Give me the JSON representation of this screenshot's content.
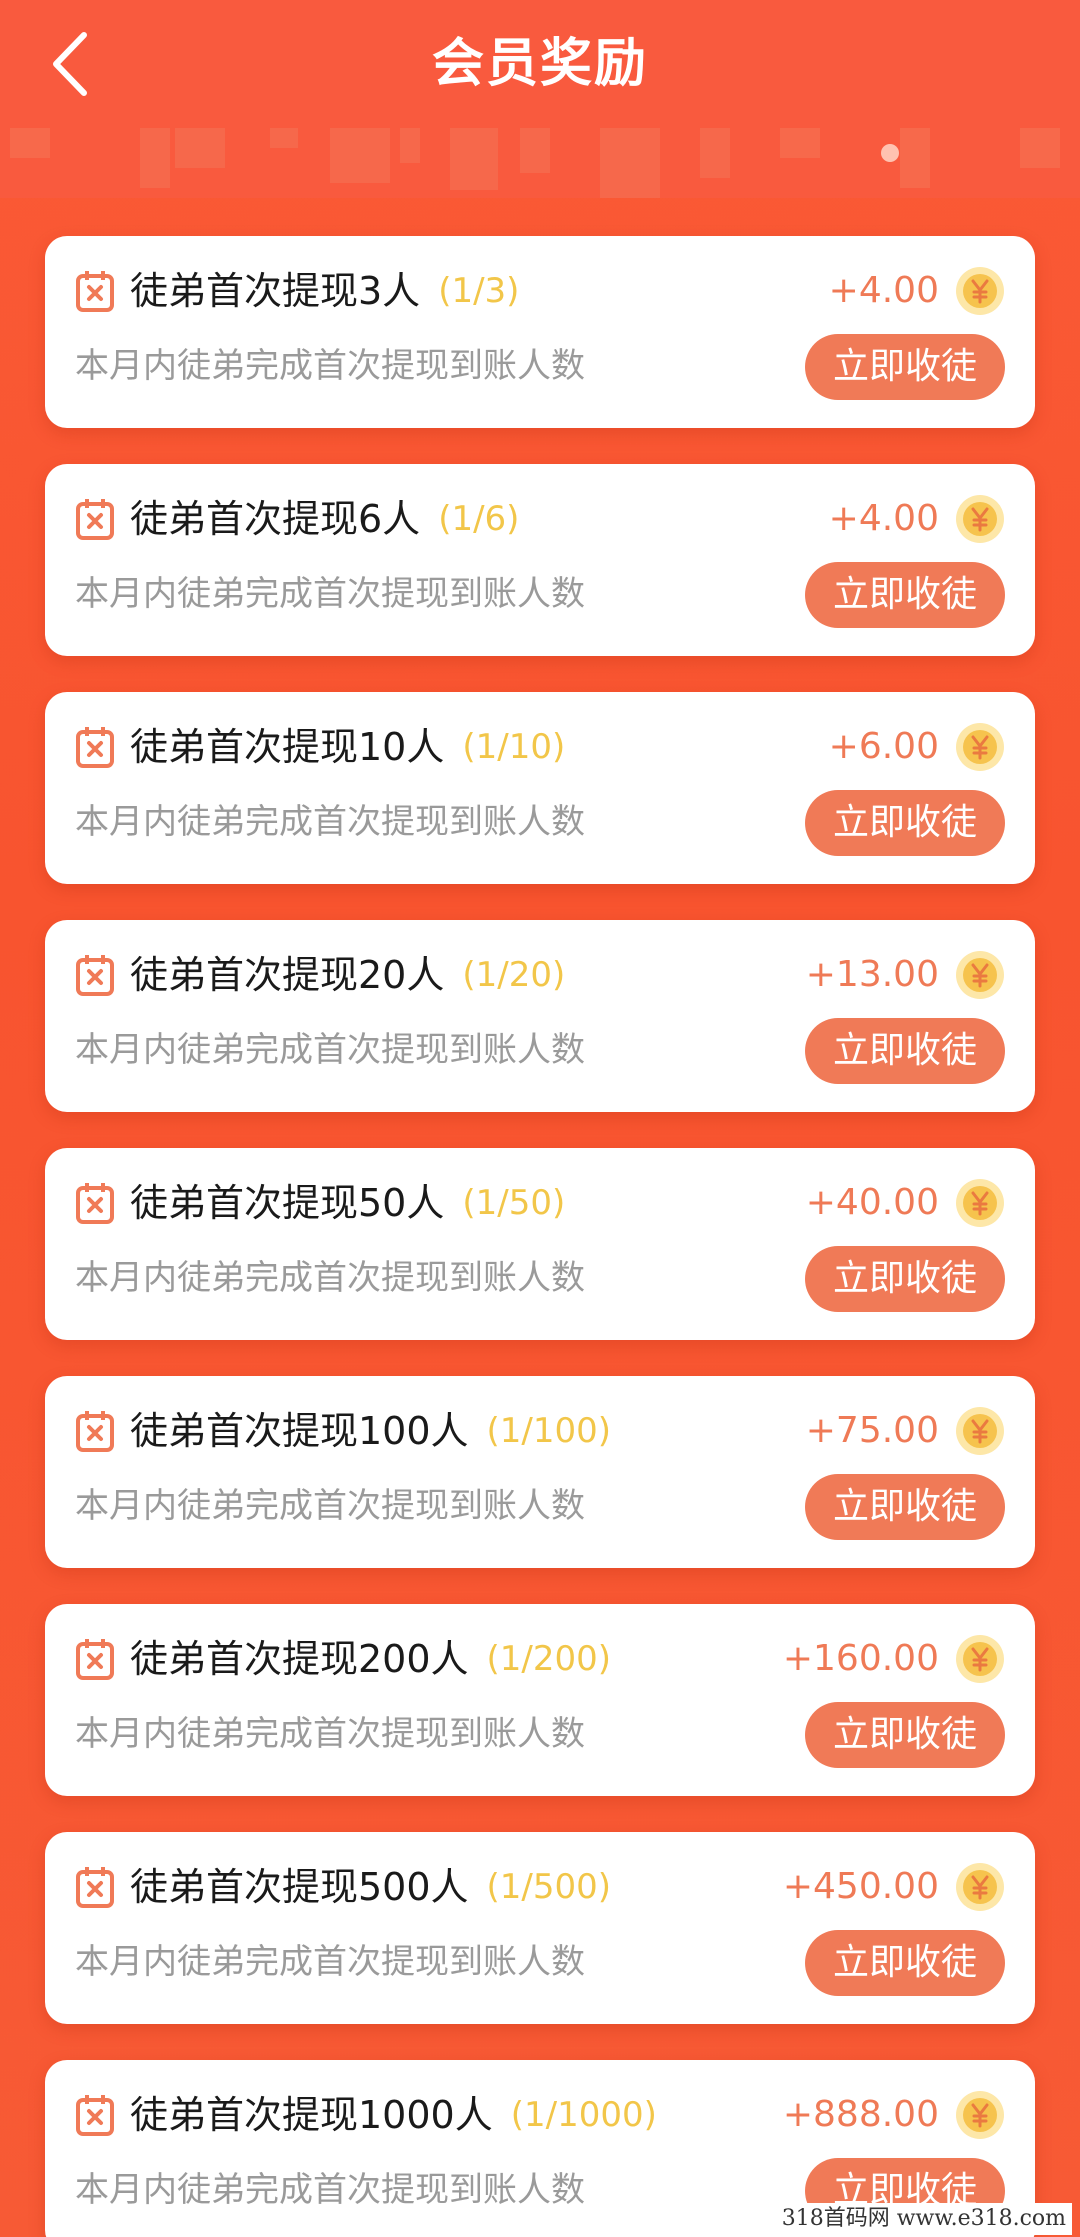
{
  "header": {
    "title": "会员奖励"
  },
  "tasks": [
    {
      "title": "徒弟首次提现3人",
      "progress": "(1/3)",
      "description": "本月内徒弟完成首次提现到账人数",
      "reward": "+4.00",
      "action": "立即收徒"
    },
    {
      "title": "徒弟首次提现6人",
      "progress": "(1/6)",
      "description": "本月内徒弟完成首次提现到账人数",
      "reward": "+4.00",
      "action": "立即收徒"
    },
    {
      "title": "徒弟首次提现10人",
      "progress": "(1/10)",
      "description": "本月内徒弟完成首次提现到账人数",
      "reward": "+6.00",
      "action": "立即收徒"
    },
    {
      "title": "徒弟首次提现20人",
      "progress": "(1/20)",
      "description": "本月内徒弟完成首次提现到账人数",
      "reward": "+13.00",
      "action": "立即收徒"
    },
    {
      "title": "徒弟首次提现50人",
      "progress": "(1/50)",
      "description": "本月内徒弟完成首次提现到账人数",
      "reward": "+40.00",
      "action": "立即收徒"
    },
    {
      "title": "徒弟首次提现100人",
      "progress": "(1/100)",
      "description": "本月内徒弟完成首次提现到账人数",
      "reward": "+75.00",
      "action": "立即收徒"
    },
    {
      "title": "徒弟首次提现200人",
      "progress": "(1/200)",
      "description": "本月内徒弟完成首次提现到账人数",
      "reward": "+160.00",
      "action": "立即收徒"
    },
    {
      "title": "徒弟首次提现500人",
      "progress": "(1/500)",
      "description": "本月内徒弟完成首次提现到账人数",
      "reward": "+450.00",
      "action": "立即收徒"
    },
    {
      "title": "徒弟首次提现1000人",
      "progress": "(1/1000)",
      "description": "本月内徒弟完成首次提现到账人数",
      "reward": "+888.00",
      "action": "立即收徒"
    }
  ],
  "watermark": "318首码网 www.e318.com",
  "icons": {
    "back": "back-arrow-icon",
    "task": "calendar-x-icon",
    "coin": "yuan-coin-icon"
  },
  "colors": {
    "header": "#f95a3e",
    "background": "#f8542f",
    "accent": "#f07a57",
    "progress": "#f2c649",
    "reward": "#ef7a56"
  }
}
